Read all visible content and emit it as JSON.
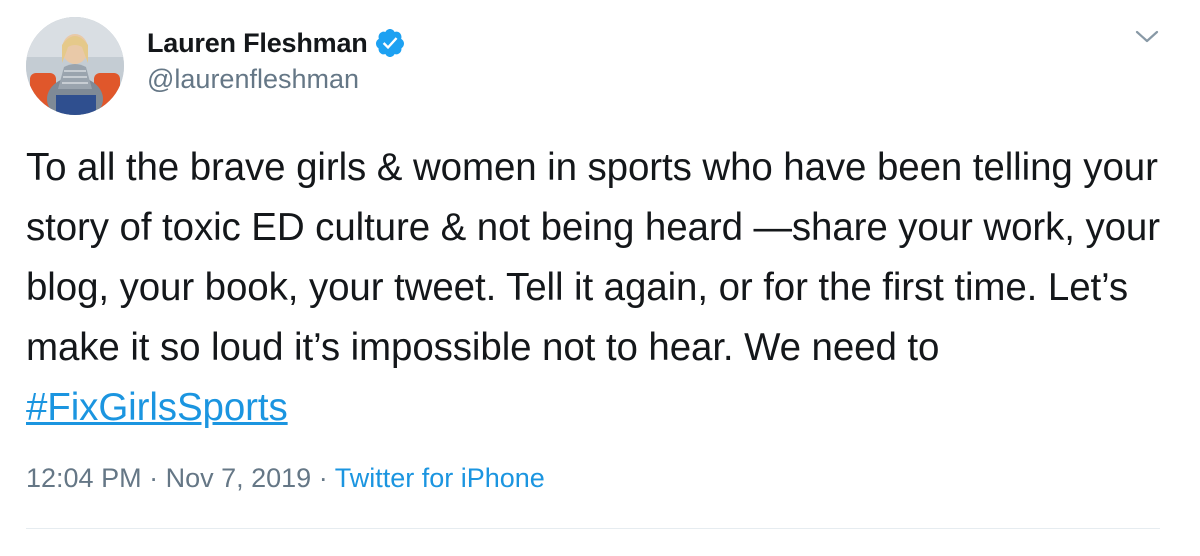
{
  "tweet": {
    "author": {
      "display_name": "Lauren Fleshman",
      "handle": "@laurenfleshman",
      "verified": true
    },
    "text_before_hashtag": "To all the brave girls & women in sports who have been telling your story of toxic ED culture & not being heard —share your work, your blog, your book, your tweet. Tell it again, or for the first time. Let’s make it so loud it’s impossible not to hear. We need to ",
    "hashtag": "#FixGirlsSports",
    "time": "12:04 PM",
    "separator_1": " · ",
    "date": "Nov 7, 2019",
    "separator_2": " · ",
    "source": "Twitter for iPhone"
  },
  "icons": {
    "verified": "verified-badge-icon",
    "caret": "chevron-down-icon"
  },
  "colors": {
    "text": "#14171a",
    "secondary": "#657786",
    "link": "#1b95e0",
    "verified": "#1da1f2",
    "divider": "#e6ecf0"
  }
}
